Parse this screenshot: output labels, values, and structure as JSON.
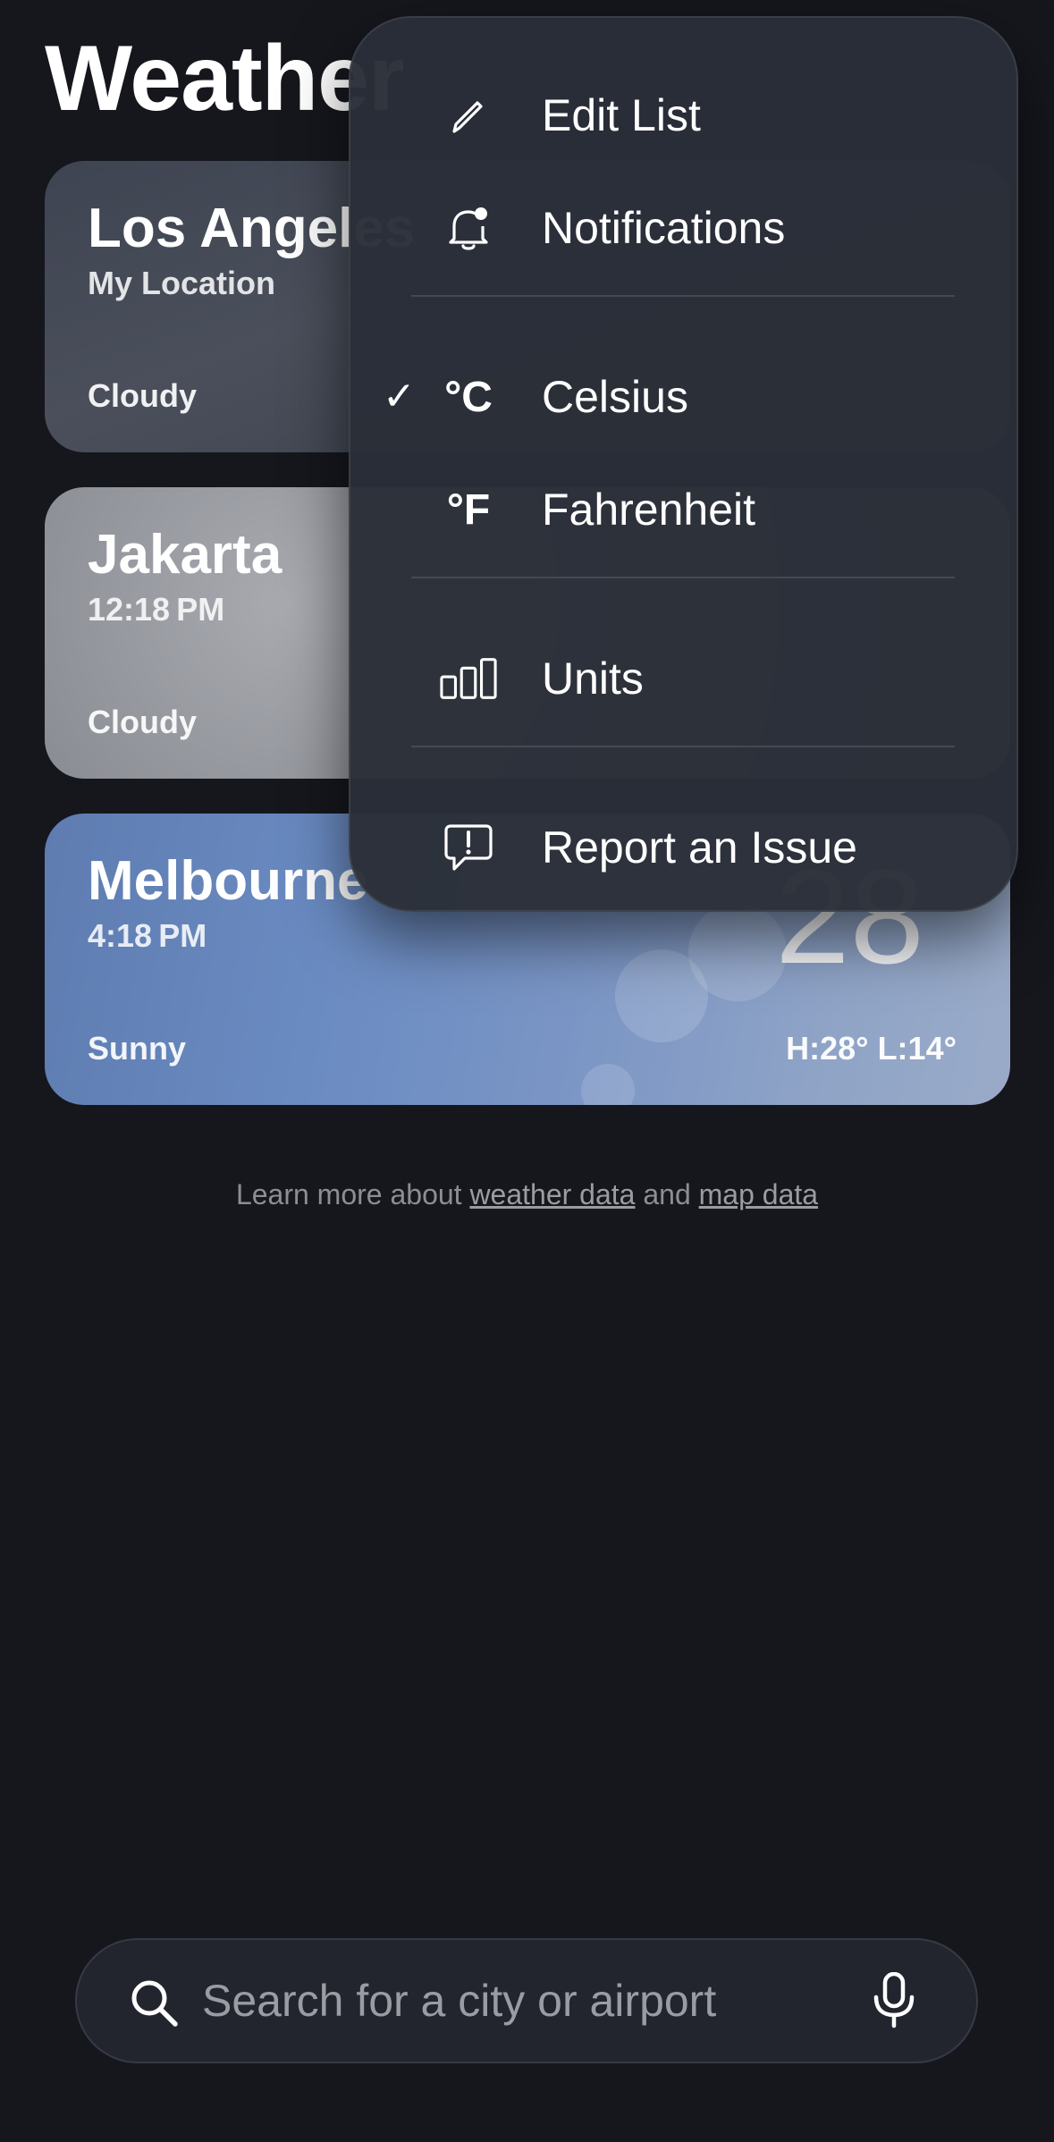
{
  "page_title": "Weather",
  "cards": [
    {
      "city": "Los Angeles",
      "subtitle": "My Location",
      "condition": "Cloudy"
    },
    {
      "city": "Jakarta",
      "subtitle": "12:18 PM",
      "condition": "Cloudy"
    },
    {
      "city": "Melbourne",
      "subtitle": "4:18 PM",
      "condition": "Sunny",
      "temp": "28",
      "high_low": "H:28°  L:14°"
    }
  ],
  "footer": {
    "prefix": "Learn more about ",
    "link1": "weather data",
    "middle": " and ",
    "link2": "map data"
  },
  "menu": {
    "edit_list": {
      "label": "Edit List",
      "icon": "pencil-icon"
    },
    "notifications": {
      "label": "Notifications",
      "icon": "bell-badge-icon"
    },
    "celsius": {
      "label": "Celsius",
      "symbol": "°C",
      "checked": true,
      "check": "✓"
    },
    "fahrenheit": {
      "label": "Fahrenheit",
      "symbol": "°F",
      "checked": false
    },
    "units": {
      "label": "Units",
      "icon": "bar-chart-icon"
    },
    "report": {
      "label": "Report an Issue",
      "icon": "exclamation-bubble-icon"
    }
  },
  "search": {
    "placeholder": "Search for a city or airport",
    "icon": "search-icon",
    "mic_icon": "microphone-icon"
  },
  "colors": {
    "background": "#16171d",
    "menu_bg": "#2a2e38",
    "melbourne_card": "#6a8bc2",
    "muted_text": "#8c8e96"
  }
}
